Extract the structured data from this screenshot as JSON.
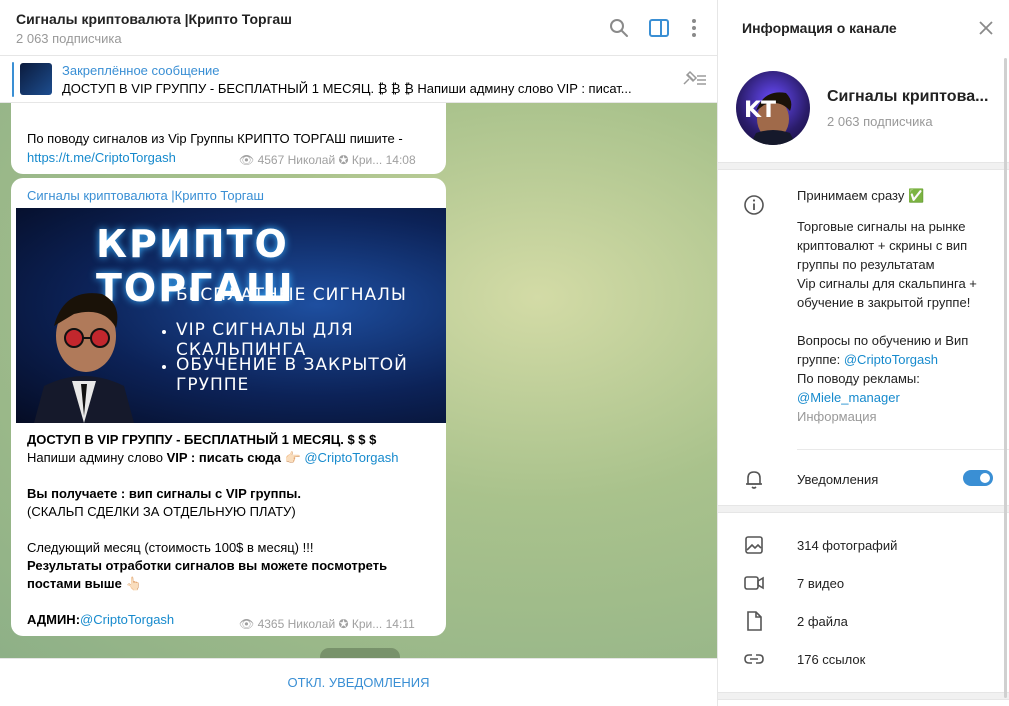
{
  "header": {
    "title": "Сигналы криптовалюта |Крипто Торгаш",
    "subscribers": "2 063 подписчика"
  },
  "pinned": {
    "label": "Закреплённое сообщение",
    "text": "ДОСТУП В VIP ГРУППУ - БЕСПЛАТНЫЙ 1 МЕСЯЦ. ₿ ₿ ₿  Напиши админу слово VIP : писат..."
  },
  "messages": [
    {
      "line1": "По поводу сигналов из Vip Группы КРИПТО ТОРГАШ пишите -",
      "link": "https://t.me/CriptoTorgash",
      "views": "4567",
      "author": "Николай ✪ Кри...",
      "time": "14:08"
    },
    {
      "channel": "Сигналы криптовалюта |Крипто Торгаш",
      "banner": {
        "title": "КРИПТО ТОРГАШ",
        "lines": [
          "БЕСПЛАТНЫЕ СИГНАЛЫ",
          "VIP СИГНАЛЫ ДЛЯ СКАЛЬПИНГА",
          "ОБУЧЕНИЕ В ЗАКРЫТОЙ ГРУППЕ"
        ]
      },
      "p1": "ДОСТУП В VIP ГРУППУ - БЕСПЛАТНЫЙ 1 МЕСЯЦ. $ $ $",
      "p2a": "Напиши админу слово ",
      "p2b": "VIP : писать сюда 👉🏻 ",
      "p2link": "@CriptoTorgash",
      "p3": "Вы получаете : вип сигналы с VIP группы.",
      "p4": "(СКАЛЬП СДЕЛКИ ЗА ОТДЕЛЬНУЮ ПЛАТУ)",
      "p5": "Следующий месяц (стоимость 100$ в месяц) !!!",
      "p6": "Результаты отработки сигналов вы можете посмотреть постами выше 👆🏻",
      "p7a": "АДМИН:",
      "p7link": "@CriptoTorgash",
      "views": "4365",
      "author": "Николай ✪ Кри...",
      "time": "14:11"
    }
  ],
  "footer": {
    "button": "ОТКЛ. УВЕДОМЛЕНИЯ"
  },
  "info": {
    "title": "Информация о канале",
    "channel_name": "Сигналы криптова...",
    "subscribers": "2 063 подписчика",
    "avatar_letters": "KT",
    "desc": {
      "l1": "Принимаем сразу ✅",
      "l2": "Торговые сигналы на рынке криптовалют + скрины с вип группы по результатам",
      "l3": "Vip сигналы для скальпинга + обучение в закрытой группе!",
      "l4": "Вопросы по обучению и Вип группе: ",
      "l4link": "@CriptoTorgash",
      "l5": "По поводу рекламы:",
      "l5link": "@Miele_manager",
      "label": "Информация"
    },
    "notifications": "Уведомления",
    "media": {
      "photos": "314 фотографий",
      "videos": "7 видео",
      "files": "2 файла",
      "links": "176 ссылок"
    }
  },
  "colors": {
    "accent": "#3a8fd4",
    "link": "#168acd"
  }
}
